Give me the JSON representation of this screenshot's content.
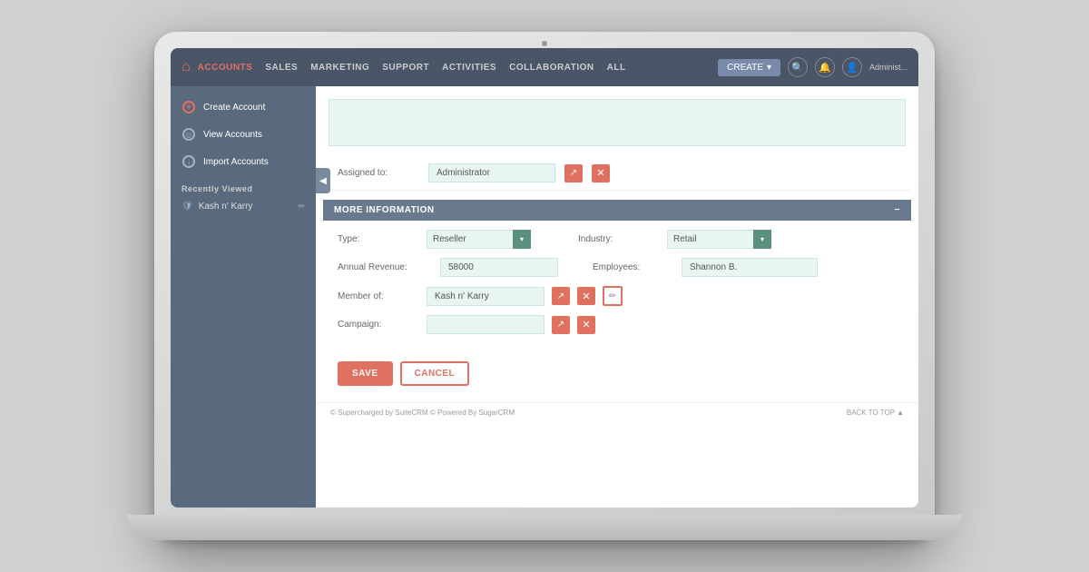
{
  "nav": {
    "items": [
      {
        "label": "ACCOUNTS",
        "active": true
      },
      {
        "label": "SALES",
        "active": false
      },
      {
        "label": "MARKETING",
        "active": false
      },
      {
        "label": "SUPPORT",
        "active": false
      },
      {
        "label": "ACTIVITIES",
        "active": false
      },
      {
        "label": "COLLABORATION",
        "active": false
      },
      {
        "label": "ALL",
        "active": false
      }
    ],
    "create_label": "CREATE",
    "admin_label": "Administ..."
  },
  "sidebar": {
    "items": [
      {
        "label": "Create Account",
        "icon": "plus"
      },
      {
        "label": "View Accounts",
        "icon": "view"
      },
      {
        "label": "Import Accounts",
        "icon": "import"
      }
    ],
    "recently_viewed_title": "Recently Viewed",
    "recent_items": [
      {
        "label": "Kash n' Karry"
      }
    ]
  },
  "form": {
    "assigned_to_label": "Assigned to:",
    "assigned_to_value": "Administrator",
    "more_info_header": "MORE INFORMATION",
    "fields": {
      "type_label": "Type:",
      "type_value": "Reseller",
      "industry_label": "Industry:",
      "industry_value": "Retail",
      "annual_revenue_label": "Annual Revenue:",
      "annual_revenue_value": "58000",
      "employees_label": "Employees:",
      "employees_value": "Shannon B.",
      "member_of_label": "Member of:",
      "member_of_value": "Kash n' Karry",
      "campaign_label": "Campaign:",
      "campaign_value": ""
    },
    "save_label": "SAVE",
    "cancel_label": "CANCEL"
  },
  "footer": {
    "copyright": "© Supercharged by SuiteCRM  © Powered By SugarCRM",
    "back_to_top": "BACK TO TOP"
  }
}
